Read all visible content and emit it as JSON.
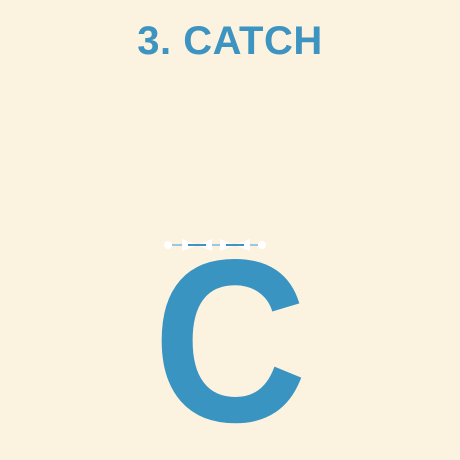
{
  "title": "3. CATCH",
  "letter": "C",
  "colors": {
    "background": "#fbf2df",
    "accent": "#3e94c1",
    "sprite": "#ffffff"
  },
  "icons": {
    "sprite": "bowtie-sprite-icon"
  }
}
